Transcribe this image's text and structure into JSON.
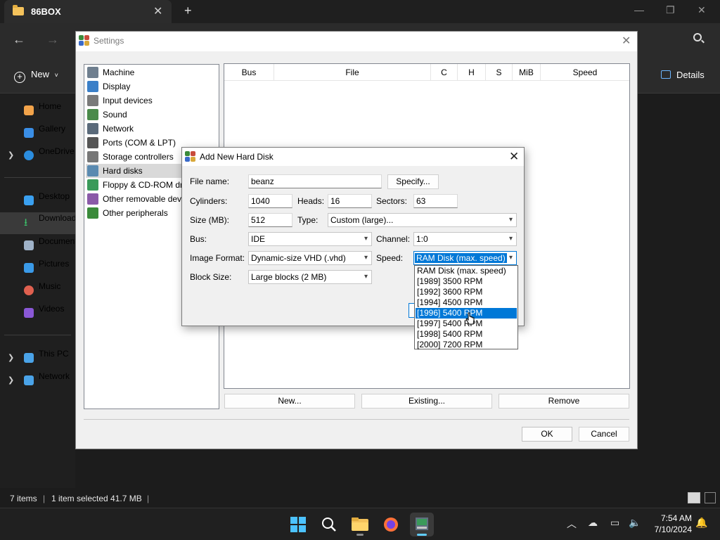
{
  "explorer": {
    "tab_title": "86BOX",
    "command": {
      "new_label": "New",
      "details_label": "Details"
    },
    "nav": [
      {
        "label": "Home",
        "color": "#f2a34a"
      },
      {
        "label": "Gallery",
        "color": "#3a8ee6"
      },
      {
        "label": "OneDrive",
        "color": "#2b8ddf"
      },
      {
        "label": "Desktop",
        "color": "#3aa0f0"
      },
      {
        "label": "Downloads",
        "color": "#3cbf6a"
      },
      {
        "label": "Documents",
        "color": "#9fb2c8"
      },
      {
        "label": "Pictures",
        "color": "#3a9ae8"
      },
      {
        "label": "Music",
        "color": "#e0604f"
      },
      {
        "label": "Videos",
        "color": "#8a58d6"
      },
      {
        "label": "This PC",
        "color": "#4aa3e8"
      },
      {
        "label": "Network",
        "color": "#4aa3e8"
      }
    ],
    "status": {
      "items": "7 items",
      "selection": "1 item selected  41.7 MB"
    }
  },
  "taskbar": {
    "time": "7:54 AM",
    "date": "7/10/2024"
  },
  "settings": {
    "title": "Settings",
    "categories": [
      {
        "label": "Machine",
        "color": "#6f7f8f"
      },
      {
        "label": "Display",
        "color": "#3a7fc8"
      },
      {
        "label": "Input devices",
        "color": "#7a7a7a"
      },
      {
        "label": "Sound",
        "color": "#4a8a4a"
      },
      {
        "label": "Network",
        "color": "#5a6a7a"
      },
      {
        "label": "Ports (COM & LPT)",
        "color": "#555555"
      },
      {
        "label": "Storage controllers",
        "color": "#777777"
      },
      {
        "label": "Hard disks",
        "color": "#5a8ab0"
      },
      {
        "label": "Floppy & CD-ROM drives",
        "color": "#3a9a5a"
      },
      {
        "label": "Other removable devices",
        "color": "#8a5aa8"
      },
      {
        "label": "Other peripherals",
        "color": "#3a8a3a"
      }
    ],
    "selected_category": "Hard disks",
    "table_columns": [
      "Bus",
      "File",
      "C",
      "H",
      "S",
      "MiB",
      "Speed"
    ],
    "buttons": {
      "new": "New...",
      "existing": "Existing...",
      "remove": "Remove",
      "ok": "OK",
      "cancel": "Cancel"
    }
  },
  "dialog": {
    "title": "Add New Hard Disk",
    "labels": {
      "file_name": "File name:",
      "cylinders": "Cylinders:",
      "heads": "Heads:",
      "sectors": "Sectors:",
      "size": "Size (MB):",
      "type": "Type:",
      "bus": "Bus:",
      "channel": "Channel:",
      "image_format": "Image Format:",
      "speed": "Speed:",
      "block_size": "Block Size:"
    },
    "values": {
      "file_name": "beanz",
      "cylinders": "1040",
      "heads": "16",
      "sectors": "63",
      "size": "512",
      "type": "Custom (large)...",
      "bus": "IDE",
      "channel": "1:0",
      "image_format": "Dynamic-size VHD (.vhd)",
      "speed": "RAM Disk (max. speed)",
      "block_size": "Large blocks (2 MB)"
    },
    "specify_label": "Specify...",
    "speed_options": [
      "RAM Disk (max. speed)",
      "[1989] 3500 RPM",
      "[1992] 3600 RPM",
      "[1994] 4500 RPM",
      "[1996] 5400 RPM",
      "[1997] 5400 RPM",
      "[1998] 5400 RPM",
      "[2000] 7200 RPM"
    ],
    "highlighted_option": "[1996] 5400 RPM"
  }
}
